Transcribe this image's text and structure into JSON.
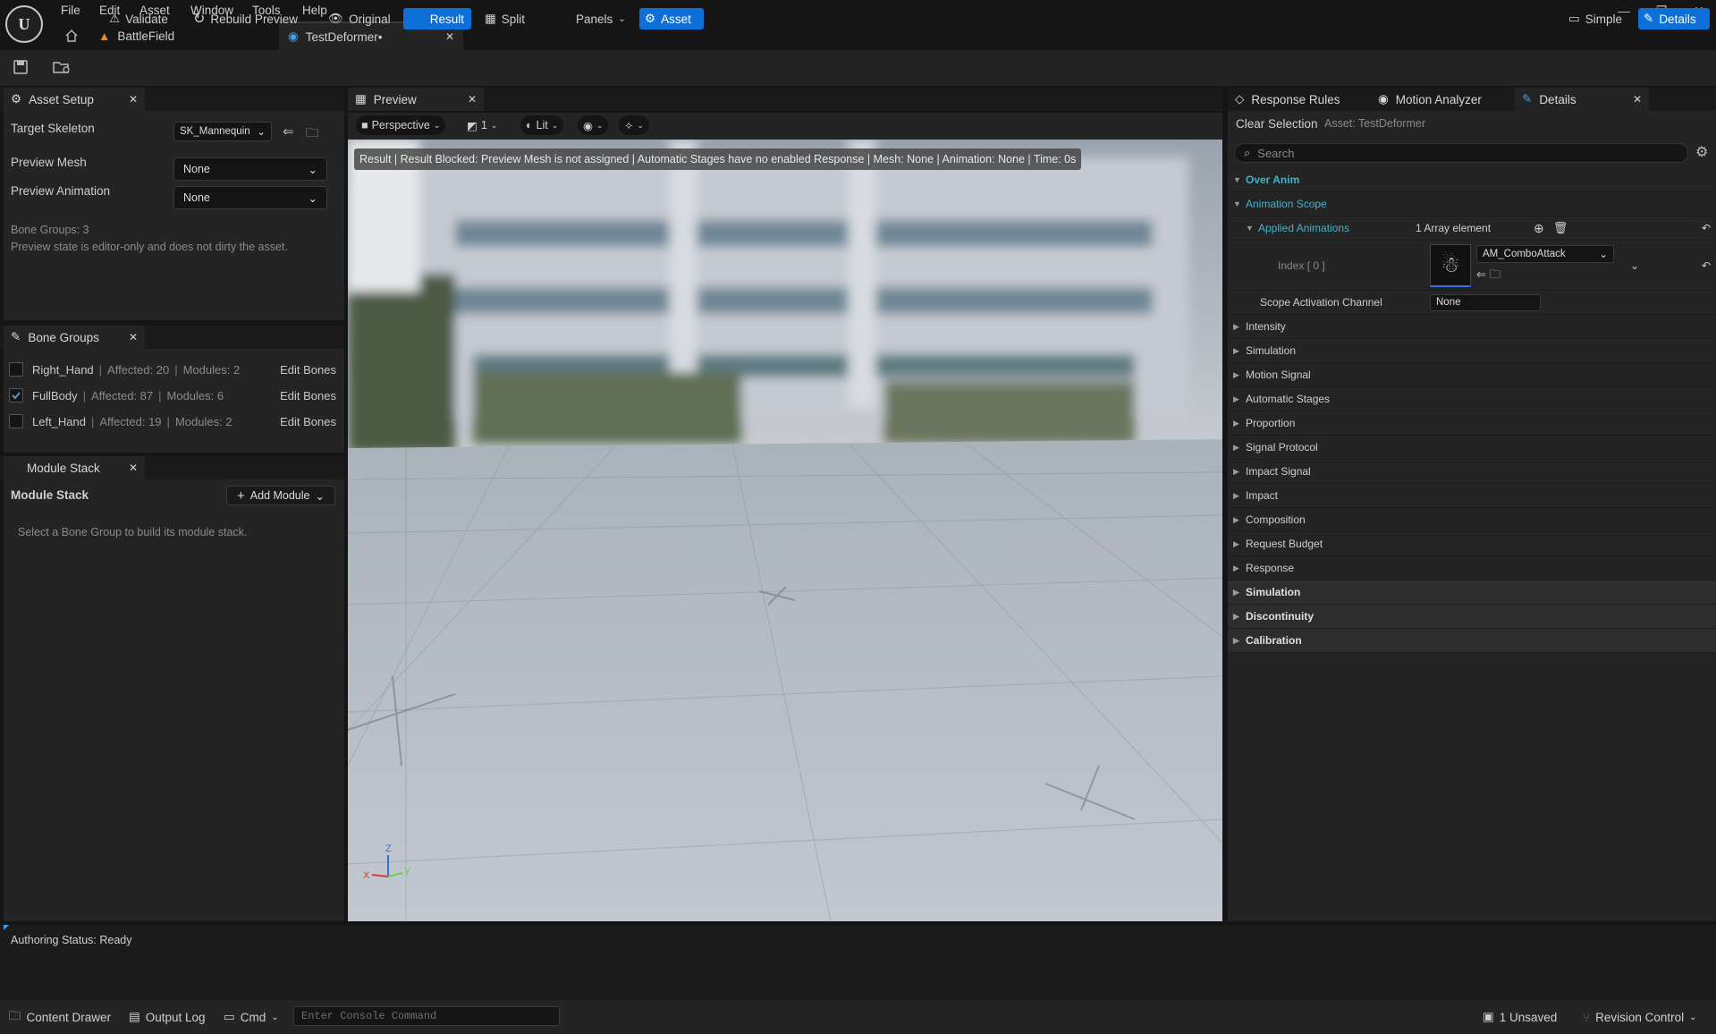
{
  "menu": [
    "File",
    "Edit",
    "Asset",
    "Window",
    "Tools",
    "Help"
  ],
  "tabs": {
    "level": "BattleField",
    "asset": "TestDeformer•"
  },
  "toolbar": {
    "validate": "Validate",
    "rebuild": "Rebuild Preview",
    "original": "Original",
    "result": "Result",
    "split": "Split",
    "panels": "Panels",
    "asset": "Asset",
    "simple": "Simple",
    "details": "Details"
  },
  "asset_setup": {
    "tab": "Asset Setup",
    "target_skeleton_label": "Target Skeleton",
    "target_skeleton_value": "SK_Mannequin",
    "preview_mesh_label": "Preview Mesh",
    "preview_mesh_value": "None",
    "preview_anim_label": "Preview Animation",
    "preview_anim_value": "None",
    "bone_groups_count": "Bone Groups: 3",
    "note": "Preview state is editor-only and does not dirty the asset."
  },
  "bone_groups": {
    "tab": "Bone Groups",
    "edit_label": "Edit Bones",
    "items": [
      {
        "name": "Right_Hand",
        "affected": "Affected: 20",
        "modules": "Modules: 2",
        "checked": false
      },
      {
        "name": "FullBody",
        "affected": "Affected: 87",
        "modules": "Modules: 6",
        "checked": true
      },
      {
        "name": "Left_Hand",
        "affected": "Affected: 19",
        "modules": "Modules: 2",
        "checked": false
      }
    ]
  },
  "module_stack": {
    "tab": "Module Stack",
    "title": "Module Stack",
    "add": "Add Module",
    "hint": "Select a Bone Group to build its module stack."
  },
  "preview": {
    "tab": "Preview",
    "perspective": "Perspective",
    "count": "1",
    "lit": "Lit",
    "result_bar": "Result | Result Blocked: Preview Mesh is not assigned | Automatic Stages have no enabled Response | Mesh: None | Animation: None | Time: 0s"
  },
  "details": {
    "tabs": [
      "Response Rules",
      "Motion Analyzer",
      "Details"
    ],
    "clear_selection": "Clear Selection",
    "asset_label": "Asset: TestDeformer",
    "search_placeholder": "Search",
    "over_anim": "Over Anim",
    "animation_scope": "Animation Scope",
    "applied_animations": "Applied Animations",
    "array_count": "1 Array element",
    "index_label": "Index [ 0 ]",
    "anim_value": "AM_ComboAttack",
    "scope_channel_label": "Scope Activation Channel",
    "scope_channel_value": "None",
    "categories": [
      "Intensity",
      "Simulation",
      "Motion Signal",
      "Automatic Stages",
      "Proportion",
      "Signal Protocol",
      "Impact Signal",
      "Impact",
      "Composition",
      "Request Budget",
      "Response"
    ],
    "bold_categories": [
      "Simulation",
      "Discontinuity",
      "Calibration"
    ]
  },
  "status": {
    "text": "Authoring Status: Ready"
  },
  "bottom": {
    "content_drawer": "Content Drawer",
    "output_log": "Output Log",
    "cmd": "Cmd",
    "console_placeholder": "Enter Console Command",
    "unsaved": "1 Unsaved",
    "revision": "Revision Control"
  }
}
